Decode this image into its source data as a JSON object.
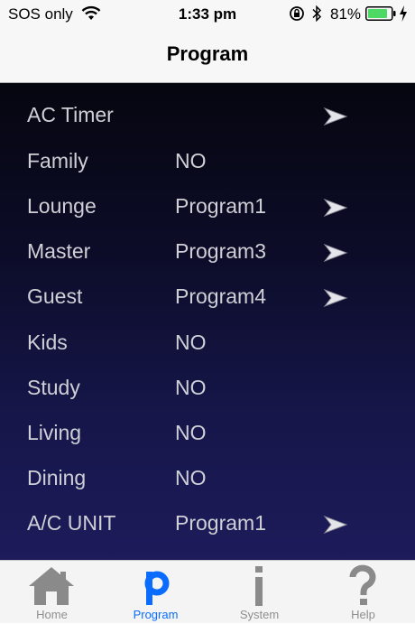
{
  "status_bar": {
    "carrier": "SOS only",
    "time": "1:33 pm",
    "battery": "81%"
  },
  "nav": {
    "title": "Program"
  },
  "rows": [
    {
      "room": "AC Timer",
      "program": "",
      "arrow": true
    },
    {
      "room": "Family",
      "program": "NO",
      "arrow": false
    },
    {
      "room": "Lounge",
      "program": "Program1",
      "arrow": true
    },
    {
      "room": "Master",
      "program": "Program3",
      "arrow": true
    },
    {
      "room": "Guest",
      "program": "Program4",
      "arrow": true
    },
    {
      "room": "Kids",
      "program": "NO",
      "arrow": false
    },
    {
      "room": "Study",
      "program": "NO",
      "arrow": false
    },
    {
      "room": "Living",
      "program": "NO",
      "arrow": false
    },
    {
      "room": "Dining",
      "program": "NO",
      "arrow": false
    },
    {
      "room": "A/C UNIT",
      "program": "Program1",
      "arrow": true
    }
  ],
  "tabs": [
    {
      "label": "Home",
      "icon": "home-icon"
    },
    {
      "label": "Program",
      "icon": "program-icon",
      "active": true
    },
    {
      "label": "System",
      "icon": "info-icon"
    },
    {
      "label": "Help",
      "icon": "help-icon"
    }
  ],
  "colors": {
    "accent": "#0a6cff",
    "list_text": "#cfd0d6",
    "battery": "#4cd964"
  }
}
